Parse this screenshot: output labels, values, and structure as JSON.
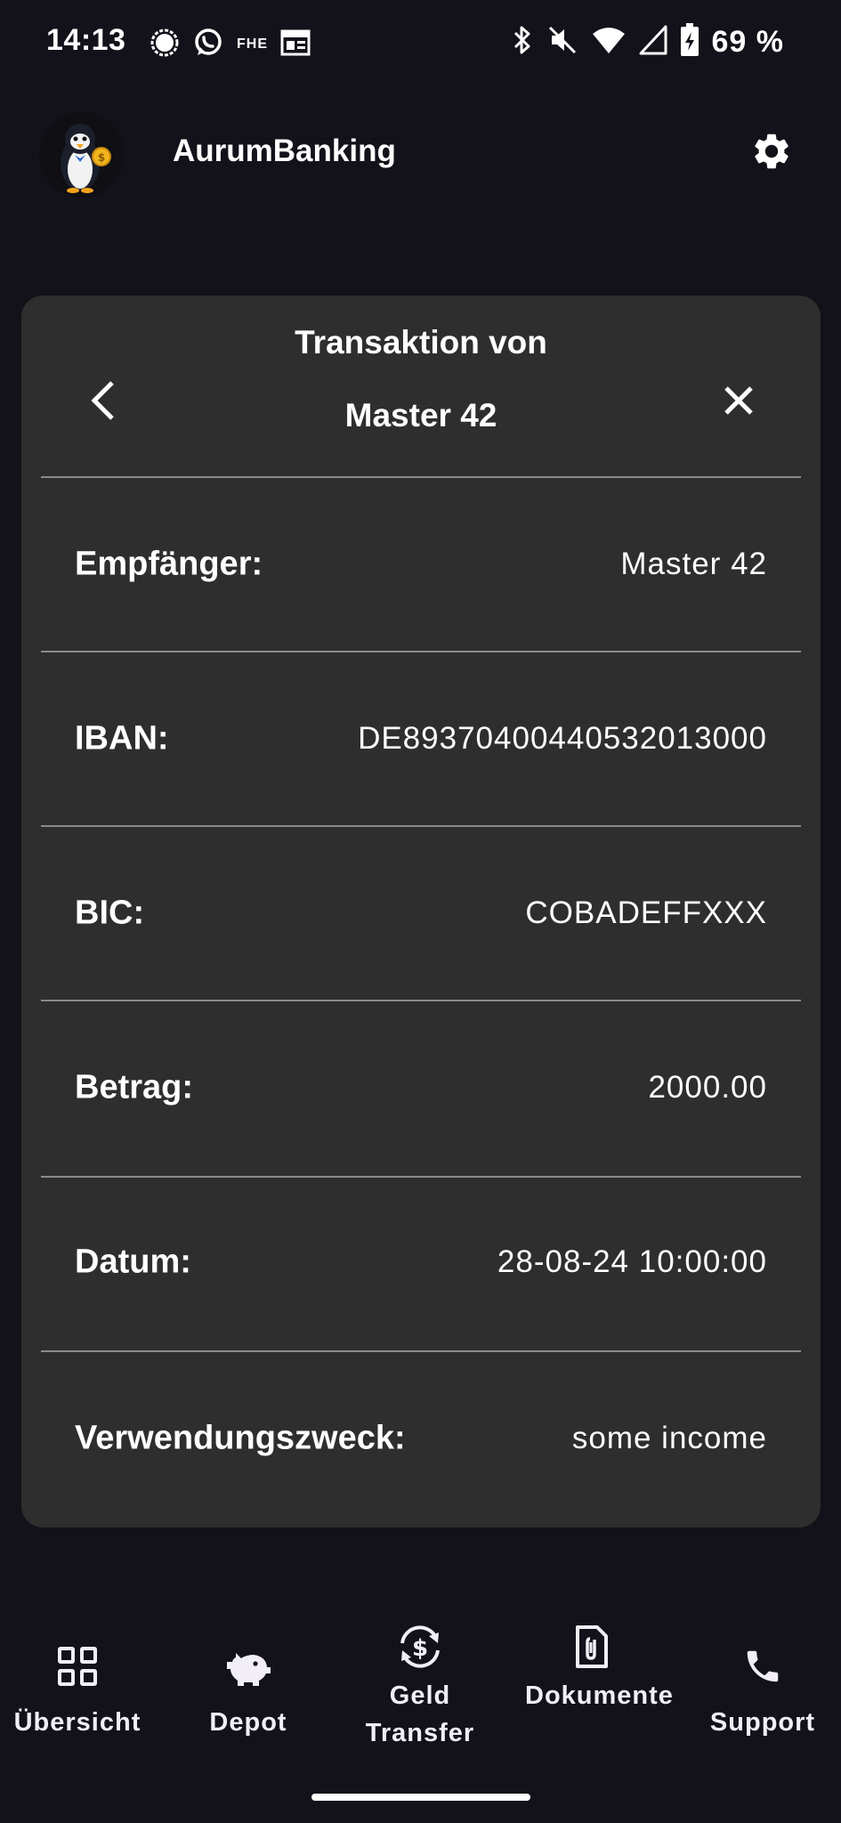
{
  "status_bar": {
    "time": "14:13",
    "left_icons": [
      "signal-messenger-icon",
      "whatsapp-icon",
      "fhe-icon",
      "calendar-news-icon"
    ],
    "fhe_text": "FHE",
    "right_icons": [
      "bluetooth-icon",
      "mute-icon",
      "wifi-icon",
      "cellular-icon",
      "battery-charging-icon"
    ],
    "battery": "69 %"
  },
  "header": {
    "app_title": "AurumBanking",
    "avatar_icon": "penguin-logo-icon",
    "settings_icon": "gear-icon"
  },
  "card": {
    "title_line1": "Transaktion von",
    "title_line2": "Master 42",
    "rows": [
      {
        "label": "Empfänger:",
        "value": "Master 42"
      },
      {
        "label": "IBAN:",
        "value": "DE89370400440532013000"
      },
      {
        "label": "BIC:",
        "value": "COBADEFFXXX"
      },
      {
        "label": "Betrag:",
        "value": "2000.00"
      },
      {
        "label": "Datum:",
        "value": "28-08-24 10:00:00"
      },
      {
        "label": "Verwendungszweck:",
        "value": "some income"
      }
    ]
  },
  "bottom_nav": [
    {
      "label": "Übersicht",
      "icon": "grid-icon"
    },
    {
      "label": "Depot",
      "icon": "piggy-bank-icon"
    },
    {
      "label": "Geld Transfer",
      "icon": "currency-exchange-icon"
    },
    {
      "label": "Dokumente",
      "icon": "document-attachment-icon"
    },
    {
      "label": "Support",
      "icon": "phone-icon"
    }
  ],
  "colors": {
    "background": "#13111a",
    "card": "#2e2e2e",
    "divider": "#8a8a8a",
    "text": "#ffffff"
  }
}
